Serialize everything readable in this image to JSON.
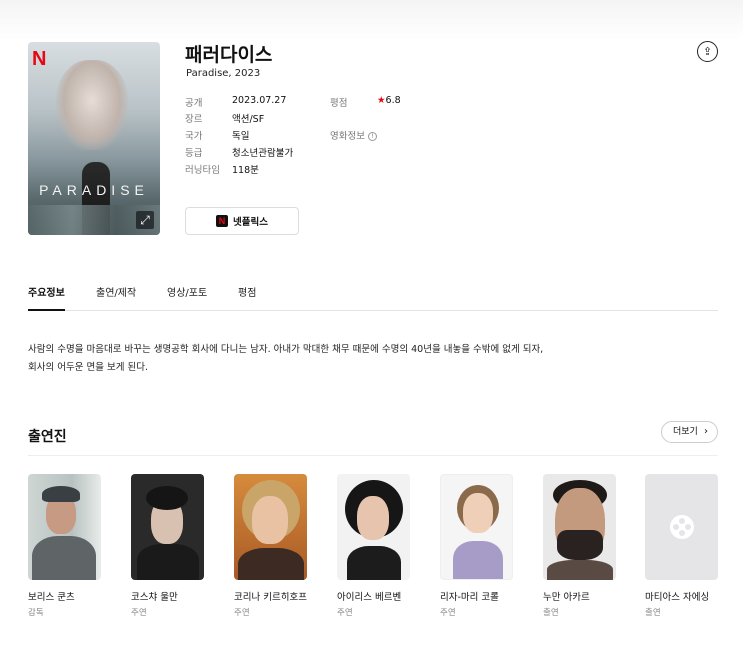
{
  "movie": {
    "title": "패러다이스",
    "subtitle": "Paradise, 2023",
    "poster_title": "PARADISE",
    "poster_logo": "N",
    "info": [
      {
        "label": "공개",
        "value": "2023.07.27"
      },
      {
        "label": "장르",
        "value": "액션/SF"
      },
      {
        "label": "국가",
        "value": "독일"
      },
      {
        "label": "등급",
        "value": "청소년관람불가"
      },
      {
        "label": "러닝타임",
        "value": "118분"
      }
    ],
    "rating_label": "평점",
    "rating_star": "★",
    "rating_value": "6.8",
    "movie_info_label": "영화정보",
    "movie_info_icon": "!",
    "ott_logo": "N",
    "ott_label": "넷플릭스",
    "share_icon": "share-icon"
  },
  "tabs": [
    {
      "label": "주요정보",
      "active": true
    },
    {
      "label": "출연/제작",
      "active": false
    },
    {
      "label": "영상/포토",
      "active": false
    },
    {
      "label": "평점",
      "active": false
    }
  ],
  "synopsis": {
    "line1": "사람의 수명을 마음대로 바꾸는 생명공학 회사에 다니는 남자. 아내가 막대한 채무 때문에 수명의 40년을 내놓을 수밖에 없게 되자,",
    "line2": "회사의 어두운 면을 보게 된다."
  },
  "cast": {
    "title": "출연진",
    "more_label": "더보기",
    "members": [
      {
        "name": "보리스 쿤츠",
        "role": "감독"
      },
      {
        "name": "코스챠 울만",
        "role": "주연"
      },
      {
        "name": "코리나 키르히호프",
        "role": "주연"
      },
      {
        "name": "아이리스 베르벤",
        "role": "주연"
      },
      {
        "name": "리자-마리 코롤",
        "role": "주연"
      },
      {
        "name": "누만 아카르",
        "role": "출연"
      },
      {
        "name": "마티아스 자에싱",
        "role": "출연"
      }
    ]
  },
  "colors": {
    "accent": "#e50914",
    "text": "#111111",
    "muted": "#777777"
  }
}
